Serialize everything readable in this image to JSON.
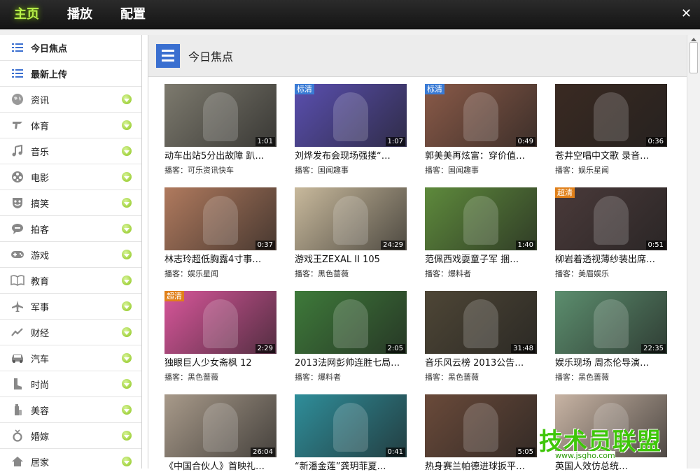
{
  "topbar": {
    "tabs": [
      "主页",
      "播放",
      "配置"
    ],
    "close": "✕"
  },
  "sidebar": {
    "items": [
      {
        "label": "今日焦点",
        "icon": "list-icon",
        "bold": true,
        "chevron": false
      },
      {
        "label": "最新上传",
        "icon": "list-icon",
        "bold": true,
        "chevron": false
      },
      {
        "label": "资讯",
        "icon": "globe-icon",
        "chevron": true
      },
      {
        "label": "体育",
        "icon": "whistle-icon",
        "chevron": true
      },
      {
        "label": "音乐",
        "icon": "music-note-icon",
        "chevron": true
      },
      {
        "label": "电影",
        "icon": "film-reel-icon",
        "chevron": true
      },
      {
        "label": "搞笑",
        "icon": "mask-icon",
        "chevron": true
      },
      {
        "label": "拍客",
        "icon": "speech-bubble-icon",
        "chevron": true
      },
      {
        "label": "游戏",
        "icon": "gamepad-icon",
        "chevron": true
      },
      {
        "label": "教育",
        "icon": "book-icon",
        "chevron": true
      },
      {
        "label": "军事",
        "icon": "airplane-icon",
        "chevron": true
      },
      {
        "label": "财经",
        "icon": "trend-icon",
        "chevron": true
      },
      {
        "label": "汽车",
        "icon": "car-icon",
        "chevron": true
      },
      {
        "label": "时尚",
        "icon": "boot-icon",
        "chevron": true
      },
      {
        "label": "美容",
        "icon": "bottle-icon",
        "chevron": true
      },
      {
        "label": "婚嫁",
        "icon": "ring-icon",
        "chevron": true
      },
      {
        "label": "居家",
        "icon": "house-icon",
        "chevron": true
      }
    ]
  },
  "main": {
    "title": "今日焦点",
    "videos": [
      {
        "title": "动车出站5分出故障 趴…",
        "uploader": "播客：可乐资讯快车",
        "duration": "1:01",
        "badge": "",
        "color": "#7d7a6e"
      },
      {
        "title": "刘烨发布会现场强搂“…",
        "uploader": "播客：国闻趣事",
        "duration": "1:07",
        "badge": "标清",
        "color": "#5a4fb0"
      },
      {
        "title": "郭美美再炫富：穿价值…",
        "uploader": "播客：国闻趣事",
        "duration": "0:49",
        "badge": "标清",
        "color": "#8a5a48"
      },
      {
        "title": "苍井空唱中文歌 录音…",
        "uploader": "播客：娱乐星闻",
        "duration": "0:36",
        "badge": "",
        "color": "#3a2a22"
      },
      {
        "title": "林志玲超低胸露4寸事…",
        "uploader": "播客：娱乐星闻",
        "duration": "0:37",
        "badge": "",
        "color": "#b07a5e"
      },
      {
        "title": "游戏王ZEXAL II  105",
        "uploader": "播客：黑色蔷薇",
        "duration": "24:29",
        "badge": "",
        "color": "#c8b99c"
      },
      {
        "title": "范佩西戏耍童子军 捆…",
        "uploader": "播客：爆料者",
        "duration": "1:40",
        "badge": "",
        "color": "#5e8a3c"
      },
      {
        "title": "柳岩着透视薄纱装出席…",
        "uploader": "播客：美眉娱乐",
        "duration": "0:51",
        "badge": "超清",
        "color": "#4a3a3a"
      },
      {
        "title": "独眼巨人少女斋枫 12",
        "uploader": "播客：黑色蔷薇",
        "duration": "2:29",
        "badge": "超清",
        "color": "#d8569a"
      },
      {
        "title": "2013法网彭帅连胜七局…",
        "uploader": "播客：爆料者",
        "duration": "2:05",
        "badge": "",
        "color": "#3e7a3a"
      },
      {
        "title": "音乐风云榜 2013公告…",
        "uploader": "播客：黑色蔷薇",
        "duration": "31:48",
        "badge": "",
        "color": "#4e4636"
      },
      {
        "title": "娱乐现场 周杰伦导演…",
        "uploader": "播客：黑色蔷薇",
        "duration": "22:35",
        "badge": "",
        "color": "#5c8e6e"
      },
      {
        "title": "《中国合伙人》首映礼…",
        "uploader": "",
        "duration": "26:04",
        "badge": "",
        "color": "#a89a8a"
      },
      {
        "title": "“新潘金莲”龚玥菲夏…",
        "uploader": "",
        "duration": "0:41",
        "badge": "",
        "color": "#2f8e9a"
      },
      {
        "title": "热身赛兰帕德进球扳平…",
        "uploader": "",
        "duration": "5:05",
        "badge": "",
        "color": "#6a4a3a"
      },
      {
        "title": "英国人效仿总统…",
        "uploader": "",
        "duration": "",
        "badge": "",
        "color": "#c8b4a4"
      }
    ]
  },
  "watermark": {
    "text": "技术员联盟",
    "sub": "www.jsgho.com"
  }
}
